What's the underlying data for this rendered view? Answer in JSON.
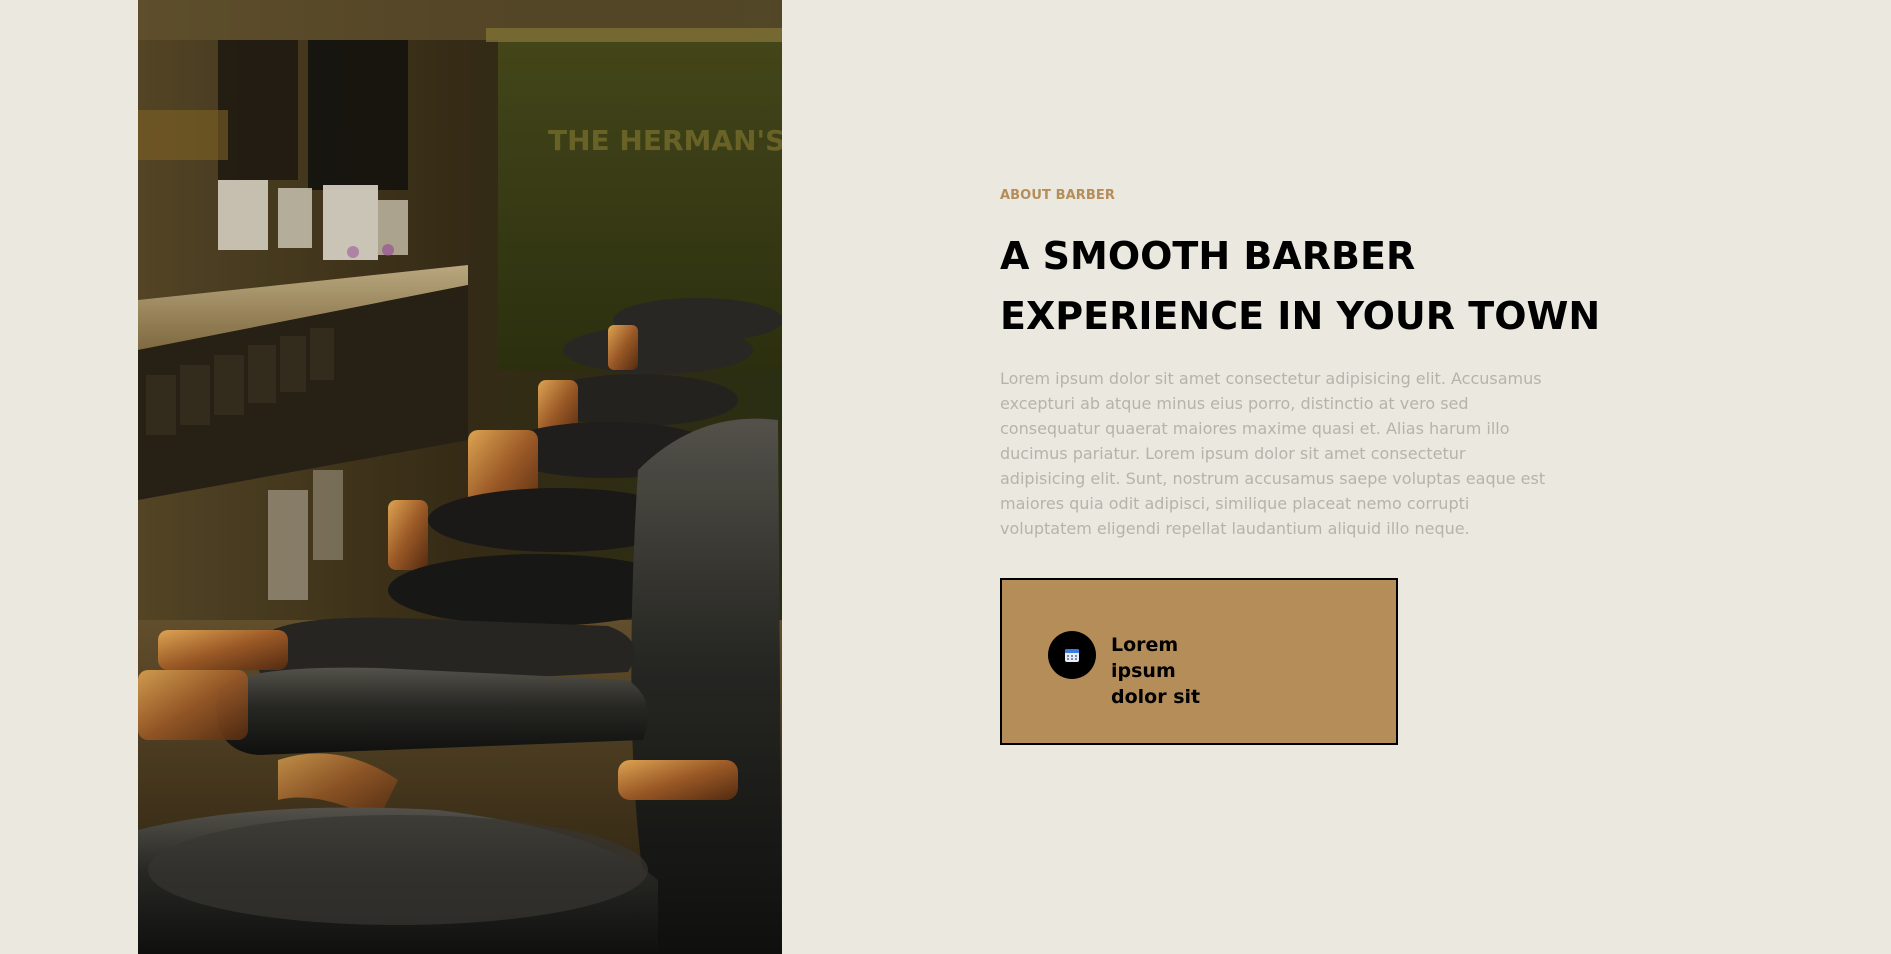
{
  "hero_image": {
    "alt_icon": "barbershop-chairs-photo"
  },
  "about": {
    "eyebrow": "ABOUT BARBER",
    "headline_line1": "A SMOOTH BARBER",
    "headline_line2": "EXPERIENCE IN YOUR TOWN",
    "paragraph": "Lorem ipsum dolor sit amet consectetur adipisicing elit. Accusamus excepturi ab atque minus eius porro, distinctio at vero sed consequatur quaerat maiores maxime quasi et. Alias harum illo ducimus pariatur. Lorem ipsum dolor sit amet consectetur adipisicing elit. Sunt, nostrum accusamus saepe voluptas eaque est maiores quia odit adipisci, similique placeat nemo corrupti voluptatem eligendi repellat laudantium aliquid illo neque."
  },
  "cta": {
    "icon": "calendar-icon",
    "label": "Lorem ipsum dolor sit"
  },
  "colors": {
    "background": "#eae8df",
    "accent": "#b58d59",
    "heading": "#000000",
    "body_text": "#b6b3ab"
  }
}
